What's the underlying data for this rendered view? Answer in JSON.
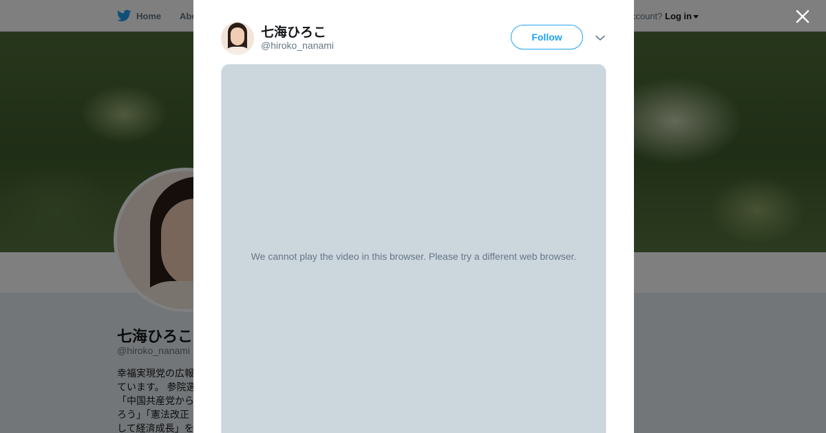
{
  "topbar": {
    "home_label": "Home",
    "about_label": "Abo",
    "account_prompt": "account?",
    "login_label": "Log in"
  },
  "profile": {
    "name": "七海ひろこ",
    "handle": "@hiroko_nanami",
    "bio_lines": [
      "幸福実現党の広報",
      "ています。 参院選",
      "「中国共産党から",
      "ろう」「憲法改正",
      "して経済成長」を"
    ]
  },
  "modal": {
    "name": "七海ひろこ",
    "handle": "@hiroko_nanami",
    "follow_label": "Follow",
    "video_message": "We cannot play the video in this browser. Please try a different web browser."
  },
  "icons": {
    "logo": "twitter-bird-icon",
    "close": "close-icon",
    "more": "chevron-down-icon"
  },
  "colors": {
    "brand": "#1da1f2",
    "text_primary": "#14171a",
    "text_secondary": "#657786",
    "video_bg": "#ccd6dd"
  }
}
